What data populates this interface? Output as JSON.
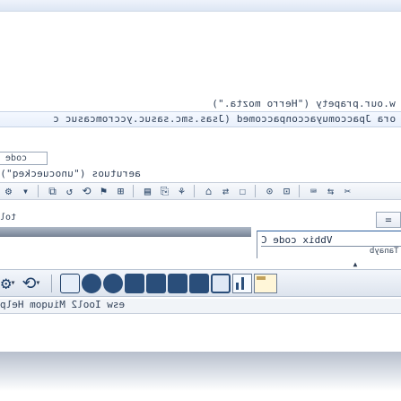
{
  "ui": {
    "line1_text": "w.our.prapety (\"Herro mozta.\")",
    "line2_text": "ora Jpaccomuyacconpaccomed (Jsas.smc.sasuc.yccromcasuc c",
    "code_tab": "code",
    "line3_text": "aerutuos (\"unocueckeq\")",
    "tol_label": "tol",
    "min_button": "=",
    "panel_title": "Vbbix code C",
    "panel_small": "Tanayb",
    "menubar_text": "esw Iool2 Miuqom Help"
  },
  "toolbar_small": {
    "items": [
      "⚙",
      "▾",
      "⧉",
      "↺",
      "⟲",
      "⚑",
      "⊞",
      "▤",
      "⎘",
      "⚘",
      "⌂",
      "⇄",
      "☐",
      "⊙",
      "⊡",
      "⌨",
      "⇆",
      "✂"
    ]
  },
  "toolbar_big": {
    "items": [
      "screen-settings",
      "dropdown",
      "refresh",
      "dropdown",
      "rect",
      "circle",
      "square",
      "square",
      "square",
      "square",
      "outline",
      "chart",
      "folder"
    ]
  },
  "colors": {
    "accent_dark": "#2a4e7a",
    "border": "#9aa7b8",
    "text": "#2f3f56"
  }
}
